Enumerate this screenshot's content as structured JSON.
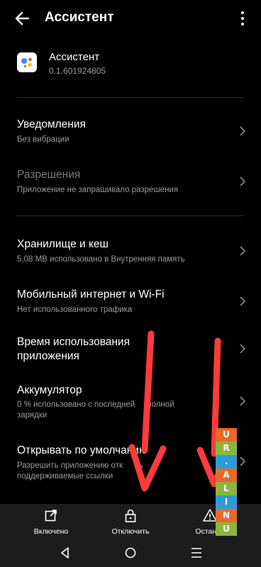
{
  "header": {
    "title": "Ассистент"
  },
  "app": {
    "name": "Ассистент",
    "version": "0.1.601924805"
  },
  "settings": [
    {
      "title": "Уведомления",
      "subtitle": "Без вибрации",
      "enabled": true
    },
    {
      "title": "Разрешения",
      "subtitle": "Приложение не запрашивало разрешения",
      "enabled": false
    },
    {
      "title": "Хранилище и кеш",
      "subtitle": "5,08 MB использовано в Внутренняя память",
      "enabled": true
    },
    {
      "title": "Мобильный интернет и Wi-Fi",
      "subtitle": "Нет использованного трафика",
      "enabled": true
    },
    {
      "title_line1": "Время использования",
      "title_line2": "приложения",
      "enabled": true
    },
    {
      "title": "Аккумулятор",
      "subtitle_line1": "0 % использовано с последней",
      "subtitle_line1_tail": "полной",
      "subtitle_line2": "зарядки",
      "enabled": true
    },
    {
      "title": "Открывать по умолчанию",
      "subtitle_line1": "Разрешить приложению отк",
      "subtitle_line1_tail": "ть",
      "subtitle_line2": "поддерживаемые ссылки",
      "enabled": true
    }
  ],
  "bottom_actions": {
    "enable": "Включено",
    "disable": "Отключить",
    "stop": "Останов"
  },
  "watermark": {
    "letters": [
      "U",
      "N",
      "I",
      "L",
      "A",
      ".",
      "R",
      "U"
    ],
    "colors": [
      "#8db43c",
      "#e8692a",
      "#2e9bd6",
      "#8db43c",
      "#e8692a",
      "#2e9bd6",
      "#8db43c",
      "#e8692a"
    ]
  },
  "colors": {
    "background": "#000000",
    "arrow": "#ff3b3b",
    "bottom_bar": "#1c1c1c"
  },
  "icons": {
    "back": "arrow-left-icon",
    "more": "more-vertical-icon",
    "enable": "open-external-icon",
    "disable": "lock-icon",
    "stop": "warning-icon",
    "nav_back": "triangle-back-icon",
    "nav_home": "circle-home-icon",
    "nav_menu": "menu-lines-icon"
  }
}
